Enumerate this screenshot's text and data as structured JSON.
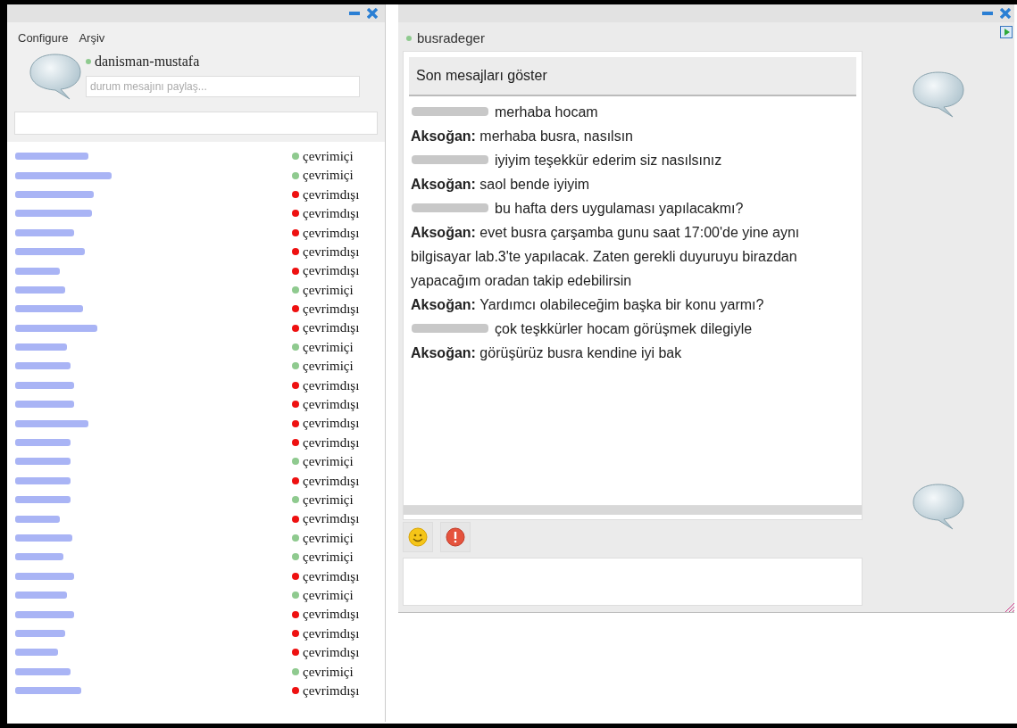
{
  "contacts_window": {
    "menu": [
      "Configure",
      "Arşiv"
    ],
    "user": {
      "name": "danisman-mustafa",
      "online": true
    },
    "status_field": {
      "placeholder": "durum mesajını paylaş..."
    },
    "contacts": [
      {
        "online": true,
        "status": "çevrimiçi"
      },
      {
        "online": true,
        "status": "çevrimiçi"
      },
      {
        "online": false,
        "status": "çevrimdışı"
      },
      {
        "online": false,
        "status": "çevrimdışı"
      },
      {
        "online": false,
        "status": "çevrimdışı"
      },
      {
        "online": false,
        "status": "çevrimdışı"
      },
      {
        "online": false,
        "status": "çevrimdışı"
      },
      {
        "online": true,
        "status": "çevrimiçi"
      },
      {
        "online": false,
        "status": "çevrimdışı"
      },
      {
        "online": false,
        "status": "çevrimdışı"
      },
      {
        "online": true,
        "status": "çevrimiçi"
      },
      {
        "online": true,
        "status": "çevrimiçi"
      },
      {
        "online": false,
        "status": "çevrimdışı"
      },
      {
        "online": false,
        "status": "çevrimdışı"
      },
      {
        "online": false,
        "status": "çevrimdışı"
      },
      {
        "online": false,
        "status": "çevrimdışı"
      },
      {
        "online": true,
        "status": "çevrimiçi"
      },
      {
        "online": false,
        "status": "çevrimdışı"
      },
      {
        "online": true,
        "status": "çevrimiçi"
      },
      {
        "online": false,
        "status": "çevrimdışı"
      },
      {
        "online": true,
        "status": "çevrimiçi"
      },
      {
        "online": true,
        "status": "çevrimiçi"
      },
      {
        "online": false,
        "status": "çevrimdışı"
      },
      {
        "online": true,
        "status": "çevrimiçi"
      },
      {
        "online": false,
        "status": "çevrimdışı"
      },
      {
        "online": false,
        "status": "çevrimdışı"
      },
      {
        "online": false,
        "status": "çevrimdışı"
      },
      {
        "online": true,
        "status": "çevrimiçi"
      },
      {
        "online": false,
        "status": "çevrimdışı"
      }
    ]
  },
  "chat_window": {
    "contact": {
      "name": "busradeger",
      "online": true
    },
    "history_button": "Son mesajları göster",
    "messages": [
      {
        "kind": "them",
        "text": "merhaba hocam"
      },
      {
        "kind": "me",
        "sender": "Aksoğan:",
        "text": "merhaba busra, nasılsın"
      },
      {
        "kind": "them",
        "text": "iyiyim teşekkür ederim siz nasılsınız"
      },
      {
        "kind": "me",
        "sender": "Aksoğan:",
        "text": "saol bende iyiyim"
      },
      {
        "kind": "them",
        "text": "bu hafta ders uygulaması yapılacakmı?"
      },
      {
        "kind": "me",
        "sender": "Aksoğan:",
        "text": "evet busra çarşamba gunu saat 17:00'de yine aynı bilgisayar lab.3'te yapılacak. Zaten gerekli duyuruyu birazdan yapacağım oradan takip edebilirsin"
      },
      {
        "kind": "me",
        "sender": "Aksoğan:",
        "text": "Yardımcı olabileceğim başka bir konu yarmı?"
      },
      {
        "kind": "them",
        "text": "çok teşkkürler hocam görüşmek dilegiyle"
      },
      {
        "kind": "me",
        "sender": "Aksoğan:",
        "text": "görüşürüz busra kendine iyi bak"
      }
    ]
  }
}
